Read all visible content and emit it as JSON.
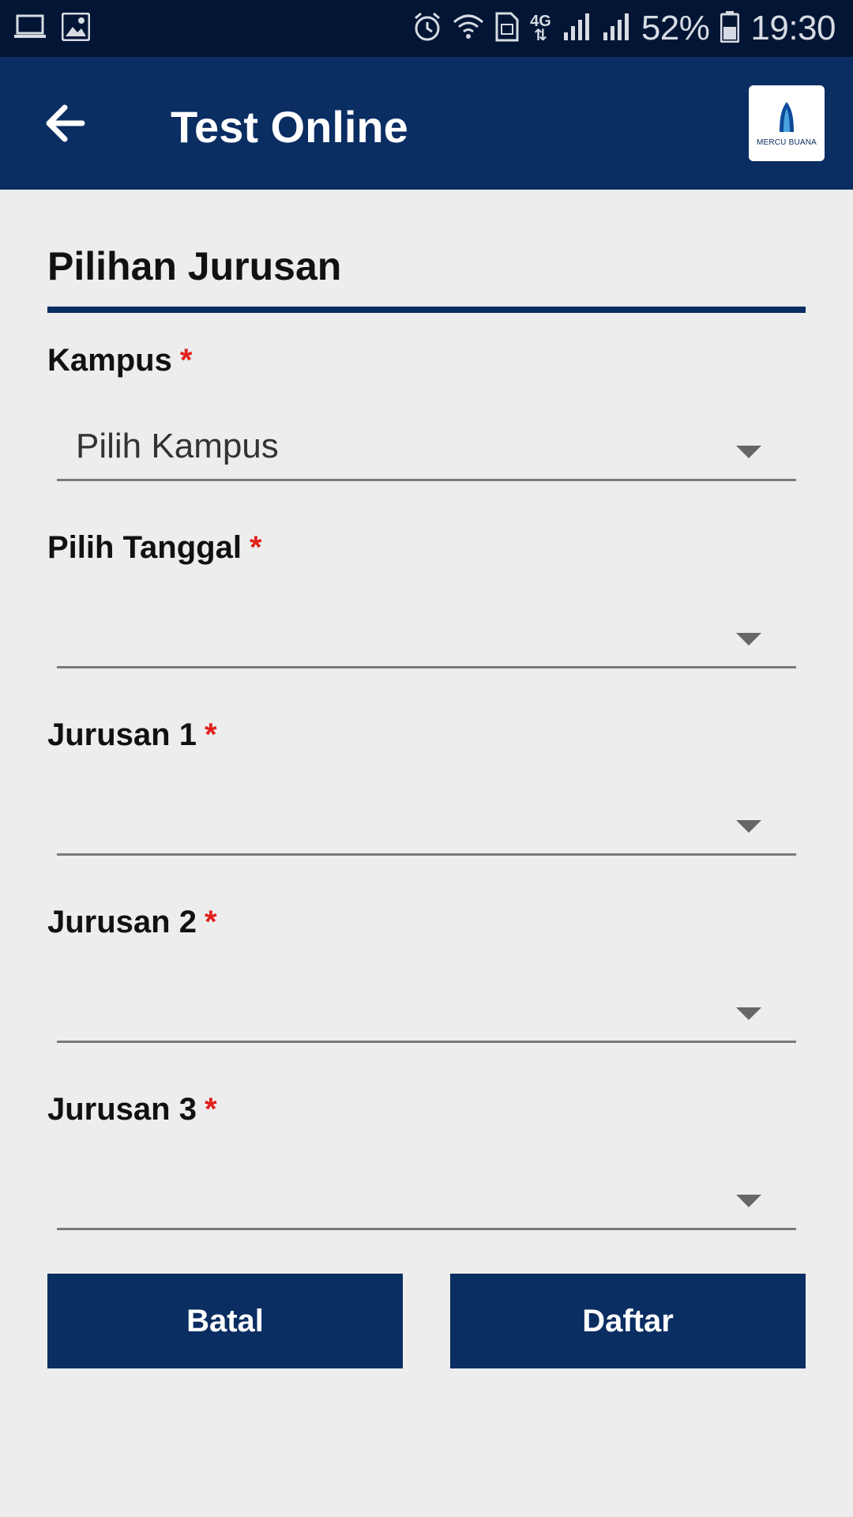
{
  "status_bar": {
    "battery": "52%",
    "time": "19:30",
    "network": "4G",
    "icons": [
      "laptop-icon",
      "image-icon",
      "alarm-icon",
      "wifi-icon",
      "sim-icon",
      "signal-icon",
      "signal-icon",
      "battery-icon"
    ]
  },
  "app_bar": {
    "title": "Test Online",
    "back_icon": "arrow-left-icon",
    "logo_text": "MERCU BUANA"
  },
  "colors": {
    "primary": "#0a2d62",
    "status_bar": "#021534",
    "required": "#e0201c",
    "background": "#ededed"
  },
  "form": {
    "section_title": "Pilihan Jurusan",
    "required_mark": "*",
    "fields": [
      {
        "label": "Kampus",
        "value": "Pilih Kampus"
      },
      {
        "label": "Pilih Tanggal",
        "value": ""
      },
      {
        "label": "Jurusan 1",
        "value": ""
      },
      {
        "label": "Jurusan 2",
        "value": ""
      },
      {
        "label": "Jurusan 3",
        "value": ""
      }
    ],
    "cancel_label": "Batal",
    "submit_label": "Daftar"
  }
}
